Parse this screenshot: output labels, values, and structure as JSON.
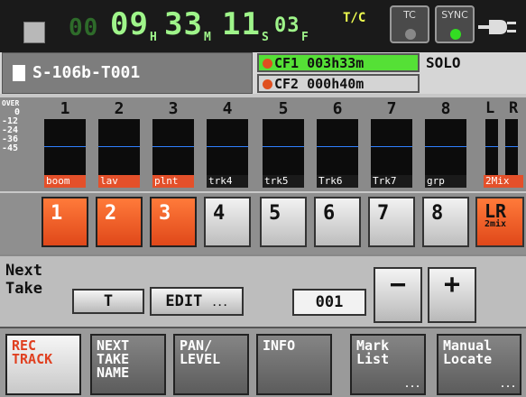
{
  "timecode": {
    "prefix_digits": "00",
    "hours": "09",
    "hours_unit": "H",
    "minutes": "33",
    "minutes_unit": "M",
    "seconds": "11",
    "seconds_unit": "S",
    "frames": "03",
    "frames_unit": "F",
    "mode_label": "T/C"
  },
  "indicators": {
    "tc_label": "TC",
    "sync_label": "SYNC",
    "tc_color": "#888888",
    "sync_color": "#33dd22"
  },
  "file": {
    "name": "S-106b-T001"
  },
  "cards": [
    {
      "label": "CF1",
      "time": "003h33m",
      "bg": "#55e036"
    },
    {
      "label": "CF2",
      "time": "000h40m",
      "bg": "#d4d4d4"
    }
  ],
  "solo_label": "SOLO",
  "meter_scale": [
    "OVER",
    "0",
    "-12",
    "-24",
    "-36",
    "-45"
  ],
  "channels": [
    {
      "num": "1",
      "name": "boom",
      "armed": true
    },
    {
      "num": "2",
      "name": "lav",
      "armed": true
    },
    {
      "num": "3",
      "name": "plnt",
      "armed": true
    },
    {
      "num": "4",
      "name": "trk4",
      "armed": false
    },
    {
      "num": "5",
      "name": "trk5",
      "armed": false
    },
    {
      "num": "6",
      "name": "Trk6",
      "armed": false
    },
    {
      "num": "7",
      "name": "Trk7",
      "armed": false
    },
    {
      "num": "8",
      "name": "grp",
      "armed": false
    }
  ],
  "mix": {
    "l": "L",
    "r": "R",
    "name": "2Mix"
  },
  "track_buttons": [
    "1",
    "2",
    "3",
    "4",
    "5",
    "6",
    "7",
    "8"
  ],
  "lr_button": {
    "main": "LR",
    "sub": "2mix"
  },
  "next_take": {
    "label_line1": "Next",
    "label_line2": "Take",
    "prefix": "T",
    "edit_label": "EDIT",
    "edit_dots": "...",
    "take_number": "001",
    "minus": "−",
    "plus": "+"
  },
  "bottom_buttons": [
    {
      "line1": "REC",
      "line2": "TRACK",
      "line3": "",
      "active": true,
      "dots": ""
    },
    {
      "line1": "NEXT",
      "line2": "TAKE",
      "line3": "NAME",
      "active": false,
      "dots": ""
    },
    {
      "line1": "PAN/",
      "line2": "LEVEL",
      "line3": "",
      "active": false,
      "dots": ""
    },
    {
      "line1": "INFO",
      "line2": "",
      "line3": "",
      "active": false,
      "dots": ""
    },
    {
      "line1": "Mark",
      "line2": "List",
      "line3": "",
      "active": false,
      "dots": "..."
    },
    {
      "line1": "Manual",
      "line2": "Locate",
      "line3": "",
      "active": false,
      "dots": "..."
    }
  ]
}
